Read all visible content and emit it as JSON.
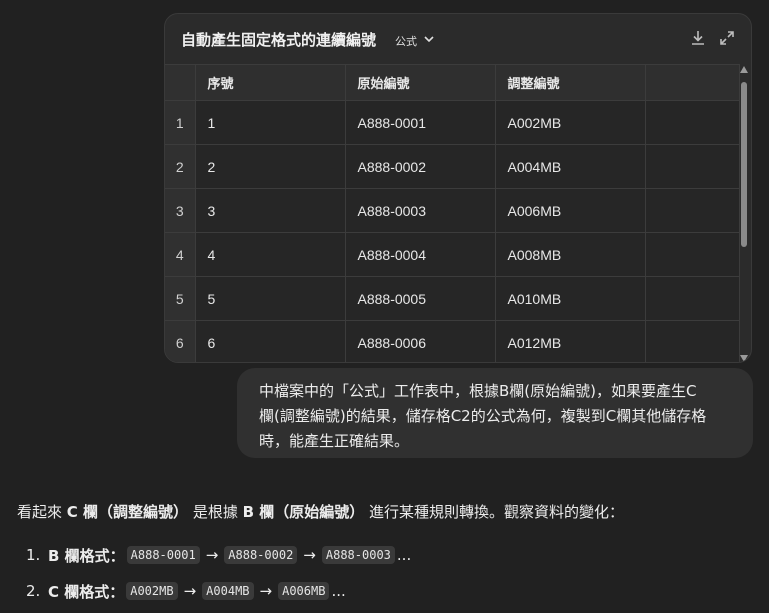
{
  "card": {
    "title": "自動產生固定格式的連續編號",
    "sheet_name": "公式",
    "icons": [
      "download-icon",
      "expand-icon"
    ]
  },
  "table": {
    "columns": [
      "",
      "序號",
      "原始編號",
      "調整編號",
      ""
    ],
    "rows": [
      [
        "1",
        "1",
        "A888-0001",
        "A002MB",
        ""
      ],
      [
        "2",
        "2",
        "A888-0002",
        "A004MB",
        ""
      ],
      [
        "3",
        "3",
        "A888-0003",
        "A006MB",
        ""
      ],
      [
        "4",
        "4",
        "A888-0004",
        "A008MB",
        ""
      ],
      [
        "5",
        "5",
        "A888-0005",
        "A010MB",
        ""
      ],
      [
        "6",
        "6",
        "A888-0006",
        "A012MB",
        ""
      ]
    ]
  },
  "user_message": {
    "line1": "中檔案中的「公式」工作表中，根據B欄(原始編號)，如果要產生C",
    "line2": "欄(調整編號)的結果，儲存格C2的公式為何，複製到C欄其他儲存格",
    "line3": "時，能產生正確結果。"
  },
  "answer": {
    "p1": "看起來",
    "b1": "C 欄（調整編號）",
    "p2": "是根據",
    "b2": "B 欄（原始編號）",
    "p3": "進行某種規則轉換。觀察資料的變化：",
    "items": [
      {
        "num": "1.",
        "label": "B 欄格式：",
        "codes": [
          "A888-0001",
          "A888-0002",
          "A888-0003"
        ],
        "arrow": "→",
        "tail": "..."
      },
      {
        "num": "2.",
        "label": "C 欄格式：",
        "codes": [
          "A002MB",
          "A004MB",
          "A006MB"
        ],
        "arrow": "→",
        "tail": "..."
      }
    ]
  }
}
